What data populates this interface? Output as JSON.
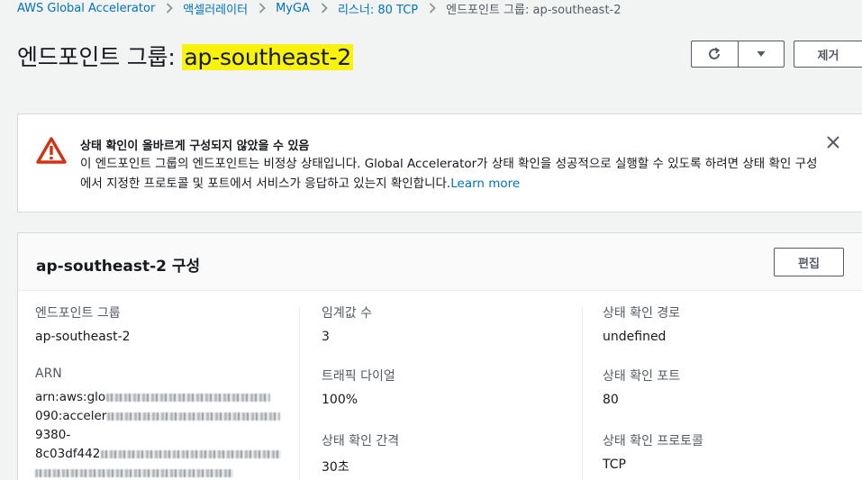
{
  "breadcrumb": {
    "items": [
      "AWS Global Accelerator",
      "액셀러레이터",
      "MyGA",
      "리스너: 80 TCP"
    ],
    "current": "엔드포인트 그룹: ap-southeast-2"
  },
  "header": {
    "title_prefix": "엔드포인트 그룹: ",
    "title_highlight": "ap-southeast-2",
    "refresh_icon": "refresh-icon",
    "dropdown_icon": "caret-down-icon",
    "remove_label": "제거",
    "highlight_color": "#f8f20c"
  },
  "alert": {
    "icon": "warning-icon",
    "title": "상태 확인이 올바르게 구성되지 않았을 수 있음",
    "body": "이 엔드포인트 그룹의 엔드포인트는 비정상 상태입니다. Global Accelerator가 상태 확인을 성공적으로 실행할 수 있도록 하려면 상태 확인 구성에서 지정한 프로토콜 및 포트에서 서비스가 응답하고 있는지 확인합니다.",
    "learn_more": "Learn more",
    "close_icon": "close-icon",
    "color": "#d13212"
  },
  "config": {
    "title": "ap-southeast-2 구성",
    "edit_label": "편집",
    "col1": {
      "group_label": "엔드포인트 그룹",
      "group_value": "ap-southeast-2",
      "arn_label": "ARN",
      "arn_lines": [
        "arn:aws:glo",
        "090:acceler",
        "9380-",
        "8c03df442"
      ]
    },
    "col2": {
      "threshold_label": "임계값 수",
      "threshold_value": "3",
      "dial_label": "트래픽 다이얼",
      "dial_value": "100%",
      "interval_label": "상태 확인 간격",
      "interval_value": "30초"
    },
    "col3": {
      "path_label": "상태 확인 경로",
      "path_value": "undefined",
      "port_label": "상태 확인 포트",
      "port_value": "80",
      "protocol_label": "상태 확인 프로토콜",
      "protocol_value": "TCP"
    }
  }
}
